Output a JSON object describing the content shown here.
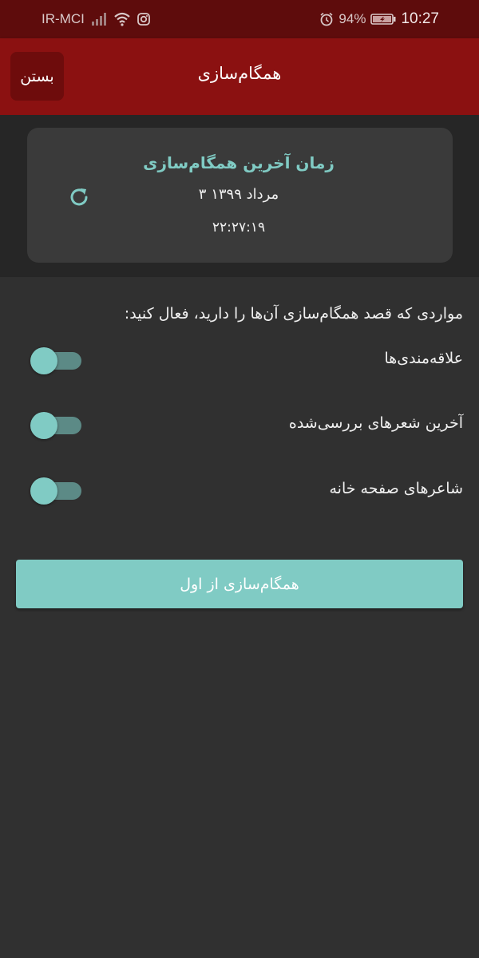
{
  "status_bar": {
    "carrier": "IR-MCI",
    "battery": "94%",
    "time": "10:27",
    "icons": [
      "signal-icon",
      "wifi-icon",
      "instagram-icon",
      "alarm-icon",
      "battery-icon"
    ]
  },
  "app_bar": {
    "title": "همگام‌سازی",
    "close_label": "بستن"
  },
  "last_sync": {
    "title": "زمان آخرین همگام‌سازی",
    "date": "۳ مرداد ۱۳۹۹",
    "time": "۲۲:۲۷:۱۹",
    "icon": "refresh-icon"
  },
  "instruction": "مواردی که قصد همگام‌سازی آن‌ها را دارید، فعال کنید:",
  "options": [
    {
      "label": "علاقه‌مندی‌ها",
      "enabled": false
    },
    {
      "label": "آخرین شعرهای بررسی‌شده",
      "enabled": false
    },
    {
      "label": "شاعرهای صفحه خانه",
      "enabled": false
    }
  ],
  "resync_button": "همگام‌سازی از اول",
  "colors": {
    "status_bar": "#5e0c0c",
    "app_bar": "#8b1111",
    "accent": "#80cbc4",
    "background": "#303030",
    "card": "#3a3a3a"
  }
}
